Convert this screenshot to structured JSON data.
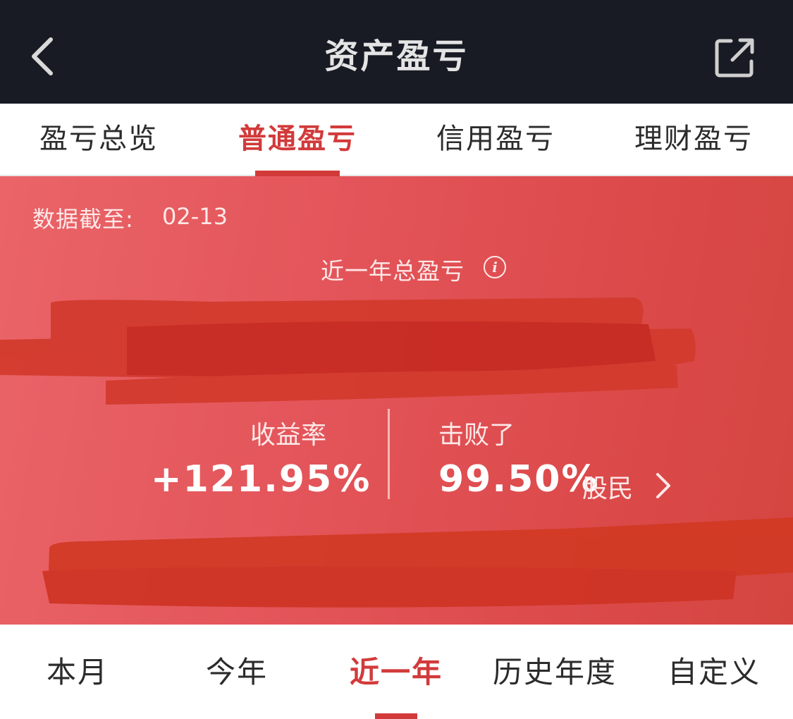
{
  "header": {
    "title": "资产盈亏",
    "back_icon": "chevron-left-icon",
    "share_icon": "share-external-icon"
  },
  "tabs": [
    {
      "label": "盈亏总览",
      "active": false
    },
    {
      "label": "普通盈亏",
      "active": true
    },
    {
      "label": "信用盈亏",
      "active": false
    },
    {
      "label": "理财盈亏",
      "active": false
    }
  ],
  "summary": {
    "date_label": "数据截至:",
    "date_value": "02-13",
    "total_label": "近一年总盈亏",
    "info_icon": "info-icon",
    "return_rate_label": "收益率",
    "return_rate_value": "+121.95%",
    "beat_label": "击败了",
    "beat_value": "99.50%",
    "beat_unit": "股民",
    "beat_link_icon": "chevron-right-icon"
  },
  "periods": [
    {
      "label": "本月",
      "active": false
    },
    {
      "label": "今年",
      "active": false
    },
    {
      "label": "近一年",
      "active": true
    },
    {
      "label": "历史年度",
      "active": false
    },
    {
      "label": "自定义",
      "active": false
    }
  ],
  "colors": {
    "topbar": "#181b24",
    "accent": "#d23a3a",
    "panel_gradient_start": "#ea6468",
    "panel_gradient_end": "#d44540",
    "redaction": "#d0362a"
  }
}
